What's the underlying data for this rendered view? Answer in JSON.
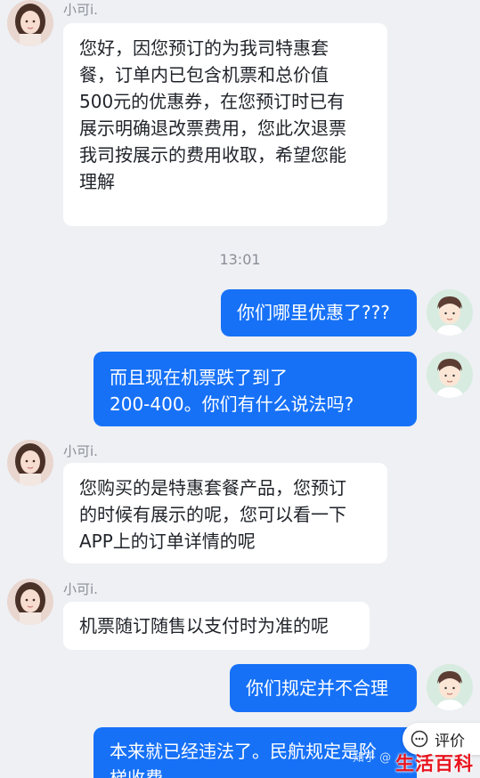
{
  "agent_name": "小可i.",
  "timestamp": "13:01",
  "messages": [
    {
      "from": "agent",
      "text": "您好，因您预订的为我司特惠套\n餐，订单内已包含机票和总价值\n500元的优惠券，在您预订时已有\n展示明确退改票费用，您此次退票\n我司按展示的费用收取，希望您能\n理解"
    },
    {
      "from": "user",
      "text": "你们哪里优惠了???"
    },
    {
      "from": "user",
      "text": "而且现在机票跌了到了\n200-400。你们有什么说法吗?"
    },
    {
      "from": "agent",
      "text": "您购买的是特惠套餐产品，您预订\n的时候有展示的呢，您可以看一下\nAPP上的订单详情的呢"
    },
    {
      "from": "agent",
      "text": "机票随订随售以支付时为准的呢"
    },
    {
      "from": "user",
      "text": "你们规定并不合理"
    },
    {
      "from": "user",
      "text": "本来就已经违法了。民航规定是阶\n梯收费"
    }
  ],
  "rate_button": {
    "label": "评价",
    "icon": "rate-icon"
  },
  "watermarks": {
    "zhihu": "知乎 @",
    "brand": "生活百科"
  },
  "colors": {
    "background": "#eef0f4",
    "user_bubble": "#1671f7",
    "agent_bubble": "#ffffff",
    "brand_watermark": "#e8141e"
  }
}
